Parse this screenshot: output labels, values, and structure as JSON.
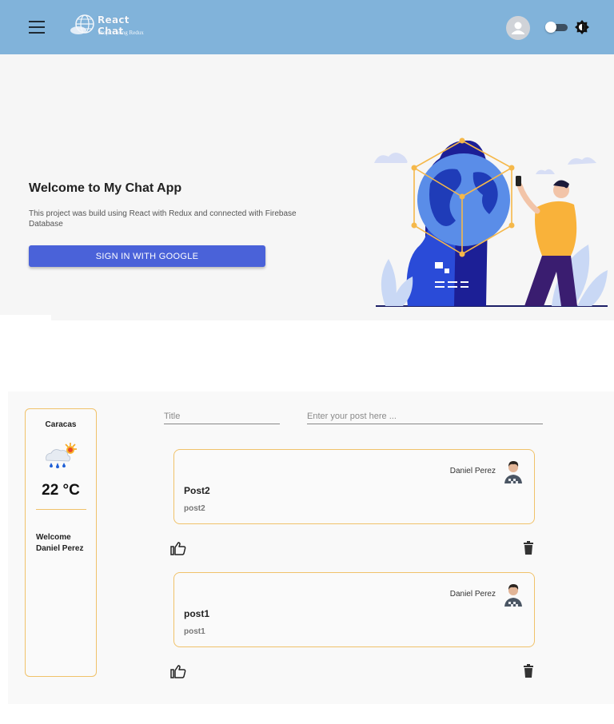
{
  "header": {
    "app_name": "React Chat",
    "app_subtitle": "Project using Redux"
  },
  "hero": {
    "title": "Welcome to My Chat App",
    "description": "This project was build using React with Redux and connected with Firebase Database",
    "signin_label": "SIGN IN WITH GOOGLE"
  },
  "weather": {
    "city": "Caracas",
    "temperature": "22 °C",
    "welcome_line1": "Welcome",
    "welcome_line2": "Daniel Perez",
    "icon": "cloud-rain-sun-icon"
  },
  "compose": {
    "title_placeholder": "Title",
    "post_placeholder": "Enter your post here ..."
  },
  "posts": [
    {
      "author": "Daniel Perez",
      "title": "Post2",
      "body": "post2"
    },
    {
      "author": "Daniel Perez",
      "title": "post1",
      "body": "post1"
    }
  ],
  "colors": {
    "appbar": "#81b3da",
    "accent": "#4a62d9",
    "card_border": "#f0c26a"
  }
}
